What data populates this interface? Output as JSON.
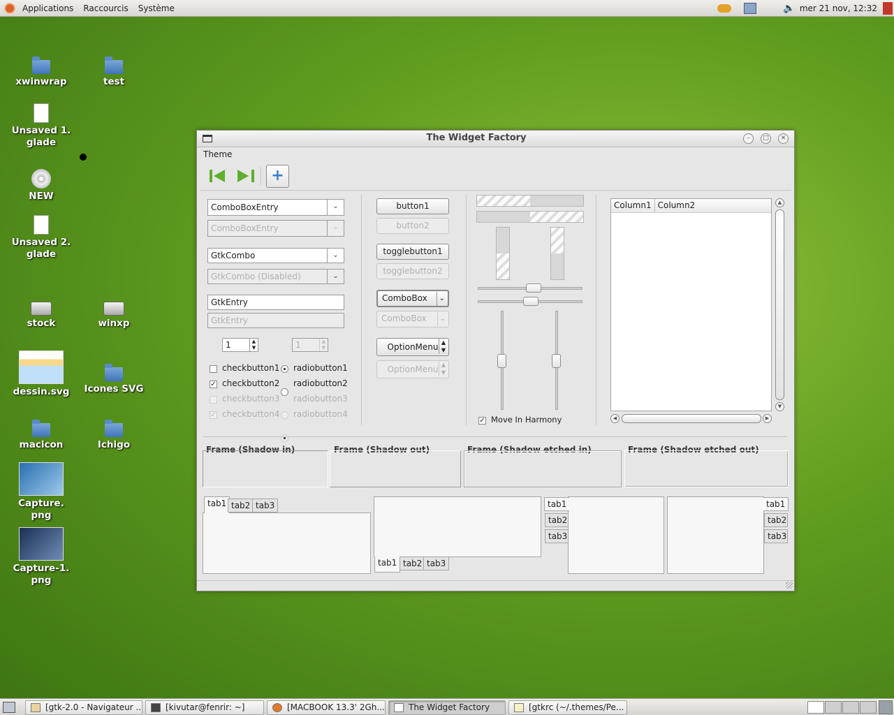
{
  "top_panel": {
    "menus": [
      "Applications",
      "Raccourcis",
      "Système"
    ],
    "clock": "mer 21 nov, 12:32"
  },
  "desktop": {
    "icons": [
      {
        "label": "xwinwrap",
        "kind": "folder"
      },
      {
        "label": "test",
        "kind": "folder"
      },
      {
        "label": "Unsaved 1.\nglade",
        "kind": "doc"
      },
      {
        "label": "NEW",
        "kind": "cd"
      },
      {
        "label": "Unsaved 2.\nglade",
        "kind": "doc"
      },
      {
        "label": "stock",
        "kind": "drive"
      },
      {
        "label": "winxp",
        "kind": "drive"
      },
      {
        "label": "dessin.svg",
        "kind": "image"
      },
      {
        "label": "Icones SVG",
        "kind": "folder"
      },
      {
        "label": "macicon",
        "kind": "folder"
      },
      {
        "label": "Ichigo",
        "kind": "folder"
      },
      {
        "label": "Capture.\npng",
        "kind": "image"
      },
      {
        "label": "Capture-1.\npng",
        "kind": "image"
      }
    ]
  },
  "window": {
    "title": "The Widget Factory",
    "menu": "Theme",
    "toolbar": {
      "first": "go-first-icon",
      "last": "go-last-icon",
      "add": "+"
    },
    "combos": {
      "combo_entry": "ComboBoxEntry",
      "combo_entry_dis": "ComboBoxEntry",
      "gtkcombo": "GtkCombo",
      "gtkcombo_dis": "GtkCombo (Disabled)",
      "entry": "GtkEntry",
      "entry_dis": "GtkEntry",
      "spin": "1",
      "spin_dis": "1"
    },
    "checks": [
      {
        "label": "checkbutton1",
        "checked": false,
        "enabled": true
      },
      {
        "label": "checkbutton2",
        "checked": true,
        "enabled": true
      },
      {
        "label": "checkbutton3",
        "checked": false,
        "enabled": false
      },
      {
        "label": "checkbutton4",
        "checked": true,
        "enabled": false
      }
    ],
    "radios": [
      {
        "label": "radiobutton1",
        "on": true,
        "enabled": true
      },
      {
        "label": "radiobutton2",
        "on": false,
        "enabled": true
      },
      {
        "label": "radiobutton3",
        "on": false,
        "enabled": false
      },
      {
        "label": "radiobutton4",
        "on": true,
        "enabled": false
      }
    ],
    "buttons": {
      "button1": "button1",
      "button2": "button2",
      "toggle1": "togglebutton1",
      "toggle2": "togglebutton2",
      "combobox": "ComboBox",
      "combobox_dis": "ComboBox",
      "optionmenu": "OptionMenu",
      "optionmenu_dis": "OptionMenu"
    },
    "harmony": {
      "label": "Move In Harmony",
      "checked": true
    },
    "tree": {
      "columns": [
        "Column1",
        "Column2"
      ]
    },
    "frames": [
      "Frame (Shadow in)",
      "Frame (Shadow out)",
      "Frame (Shadow etched in)",
      "Frame (Shadow etched out)"
    ],
    "tabs": [
      "tab1",
      "tab2",
      "tab3"
    ]
  },
  "taskbar": {
    "tasks": [
      "[gtk-2.0 - Navigateur ...",
      "[kivutar@fenrir: ~]",
      "[MACBOOK 13.3' 2Gh...",
      "The Widget Factory",
      "[gtkrc (~/.themes/Pe..."
    ]
  },
  "colors": {
    "desktop": "#5f9b1f",
    "window_bg": "#e6e6e6",
    "accent_green": "#5fae2e",
    "accent_blue": "#3d7fcf"
  }
}
